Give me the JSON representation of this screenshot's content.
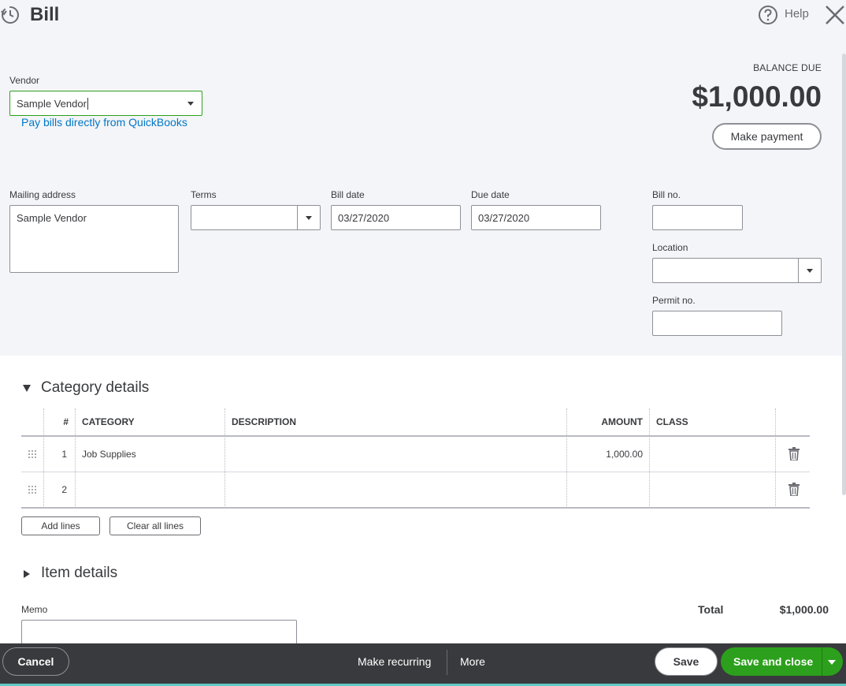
{
  "header": {
    "title": "Bill",
    "help_label": "Help"
  },
  "vendor": {
    "label": "Vendor",
    "value": "Sample Vendor",
    "link": "Pay bills directly from QuickBooks"
  },
  "balance": {
    "label": "BALANCE DUE",
    "amount": "$1,000.00",
    "make_payment_label": "Make payment"
  },
  "fields": {
    "mailing_address": {
      "label": "Mailing address",
      "value": "Sample Vendor"
    },
    "terms": {
      "label": "Terms",
      "value": ""
    },
    "bill_date": {
      "label": "Bill date",
      "value": "03/27/2020"
    },
    "due_date": {
      "label": "Due date",
      "value": "03/27/2020"
    },
    "bill_no": {
      "label": "Bill no.",
      "value": ""
    },
    "location": {
      "label": "Location",
      "value": ""
    },
    "permit_no": {
      "label": "Permit no.",
      "value": ""
    }
  },
  "category_details": {
    "title": "Category details",
    "columns": {
      "num": "#",
      "category": "CATEGORY",
      "description": "DESCRIPTION",
      "amount": "AMOUNT",
      "class": "CLASS"
    },
    "rows": [
      {
        "num": "1",
        "category": "Job Supplies",
        "description": "",
        "amount": "1,000.00",
        "class": ""
      },
      {
        "num": "2",
        "category": "",
        "description": "",
        "amount": "",
        "class": ""
      }
    ],
    "add_lines_label": "Add lines",
    "clear_lines_label": "Clear all lines"
  },
  "item_details": {
    "title": "Item details"
  },
  "memo": {
    "label": "Memo",
    "value": ""
  },
  "total": {
    "label": "Total",
    "value": "$1,000.00"
  },
  "footer": {
    "cancel_label": "Cancel",
    "make_recurring_label": "Make recurring",
    "more_label": "More",
    "save_label": "Save",
    "save_close_label": "Save and close"
  },
  "colors": {
    "accent_green": "#2ca01c",
    "link_blue": "#0077c5",
    "footer_bg": "#393a3d",
    "panel_bg": "#f4f5f8"
  }
}
